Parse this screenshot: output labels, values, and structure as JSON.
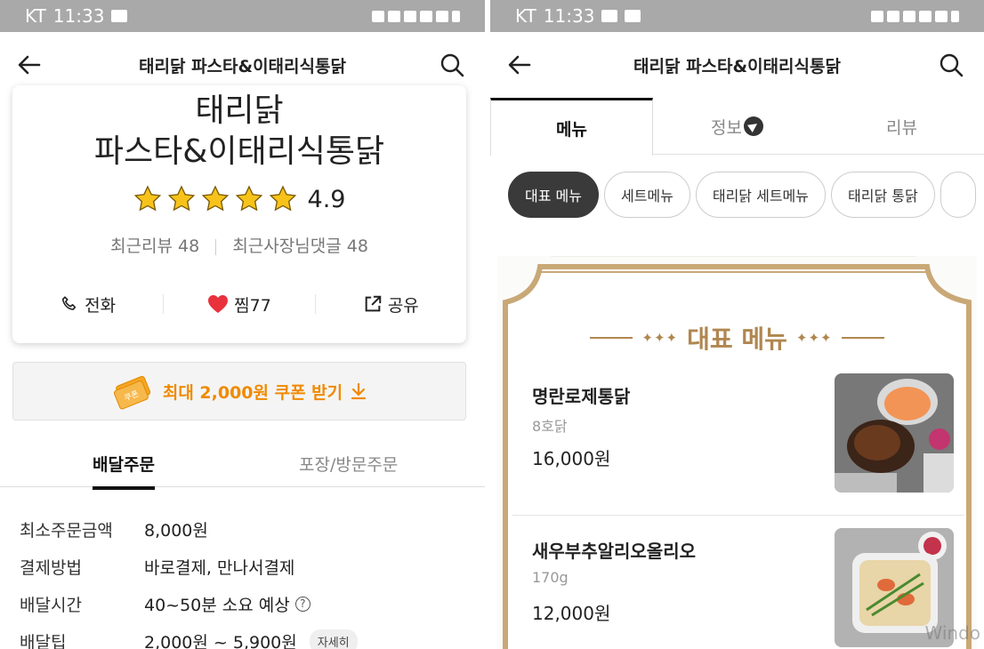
{
  "left": {
    "status": {
      "carrier": "KT",
      "time": "11:33"
    },
    "appbar": {
      "title": "태리닭 파스타&이태리식통닭"
    },
    "store": {
      "name_line1": "태리닭",
      "name_line2": "파스타&이태리식통닭",
      "rating": "4.9",
      "rating_value": 4.9,
      "recent_reviews": "최근리뷰 48",
      "owner_replies": "최근사장님댓글 48"
    },
    "actions": {
      "call": "전화",
      "like": "찜77",
      "share": "공유"
    },
    "coupon": {
      "badge": "쿠폰",
      "text": "최대 2,000원 쿠폰 받기"
    },
    "order_tabs": {
      "delivery": "배달주문",
      "pickup": "포장/방문주문"
    },
    "info": [
      {
        "label": "최소주문금액",
        "value": "8,000원"
      },
      {
        "label": "결제방법",
        "value": "바로결제, 만나서결제"
      },
      {
        "label": "배달시간",
        "value": "40~50분 소요 예상"
      },
      {
        "label": "배달팁",
        "value": "2,000원 ~ 5,900원"
      }
    ],
    "detail_badge": "자세히",
    "colors": {
      "accent": "#f08a00",
      "heart": "#e8323c",
      "star": "#f7c31b"
    }
  },
  "right": {
    "status": {
      "carrier": "KT",
      "time": "11:33"
    },
    "appbar": {
      "title": "태리닭 파스타&이태리식통닭"
    },
    "tabs": {
      "menu": "메뉴",
      "info": "정보",
      "review": "리뷰"
    },
    "chips": [
      "대표 메뉴",
      "세트메뉴",
      "태리닭 세트메뉴",
      "태리닭 통닭"
    ],
    "board_title": "대표 메뉴",
    "menu_items": [
      {
        "name": "명란로제통닭",
        "desc": "8호닭",
        "price": "16,000원"
      },
      {
        "name": "새우부추알리오올리오",
        "desc": "170g",
        "price": "12,000원"
      }
    ],
    "watermark": "Windo",
    "colors": {
      "board_border": "#c9a877",
      "board_title": "#b08750"
    }
  }
}
